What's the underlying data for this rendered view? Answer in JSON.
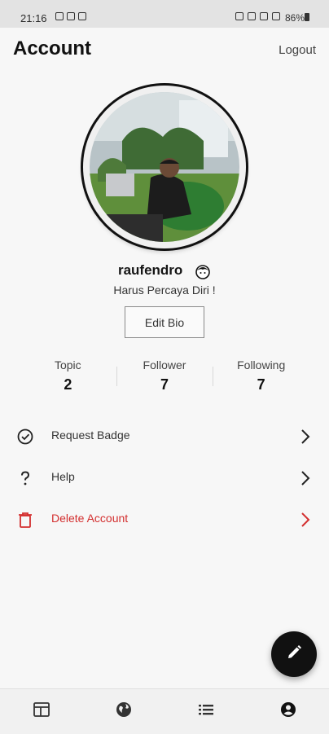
{
  "status_bar": {
    "time": "21:16",
    "battery": "86%"
  },
  "header": {
    "title": "Account",
    "logout_label": "Logout"
  },
  "profile": {
    "username": "raufendro",
    "bio": "Harus Percaya Diri !",
    "edit_bio_label": "Edit Bio"
  },
  "stats": [
    {
      "label": "Topic",
      "value": "2"
    },
    {
      "label": "Follower",
      "value": "7"
    },
    {
      "label": "Following",
      "value": "7"
    }
  ],
  "menu": [
    {
      "label": "Request Badge",
      "icon": "check-circle-icon"
    },
    {
      "label": "Help",
      "icon": "question-icon"
    },
    {
      "label": "Delete Account",
      "icon": "trash-icon"
    }
  ],
  "colors": {
    "danger": "#d32f2f",
    "fab": "#111111"
  },
  "bottom_nav": {
    "items": [
      "feed-icon",
      "globe-icon",
      "list-icon",
      "profile-icon"
    ]
  }
}
